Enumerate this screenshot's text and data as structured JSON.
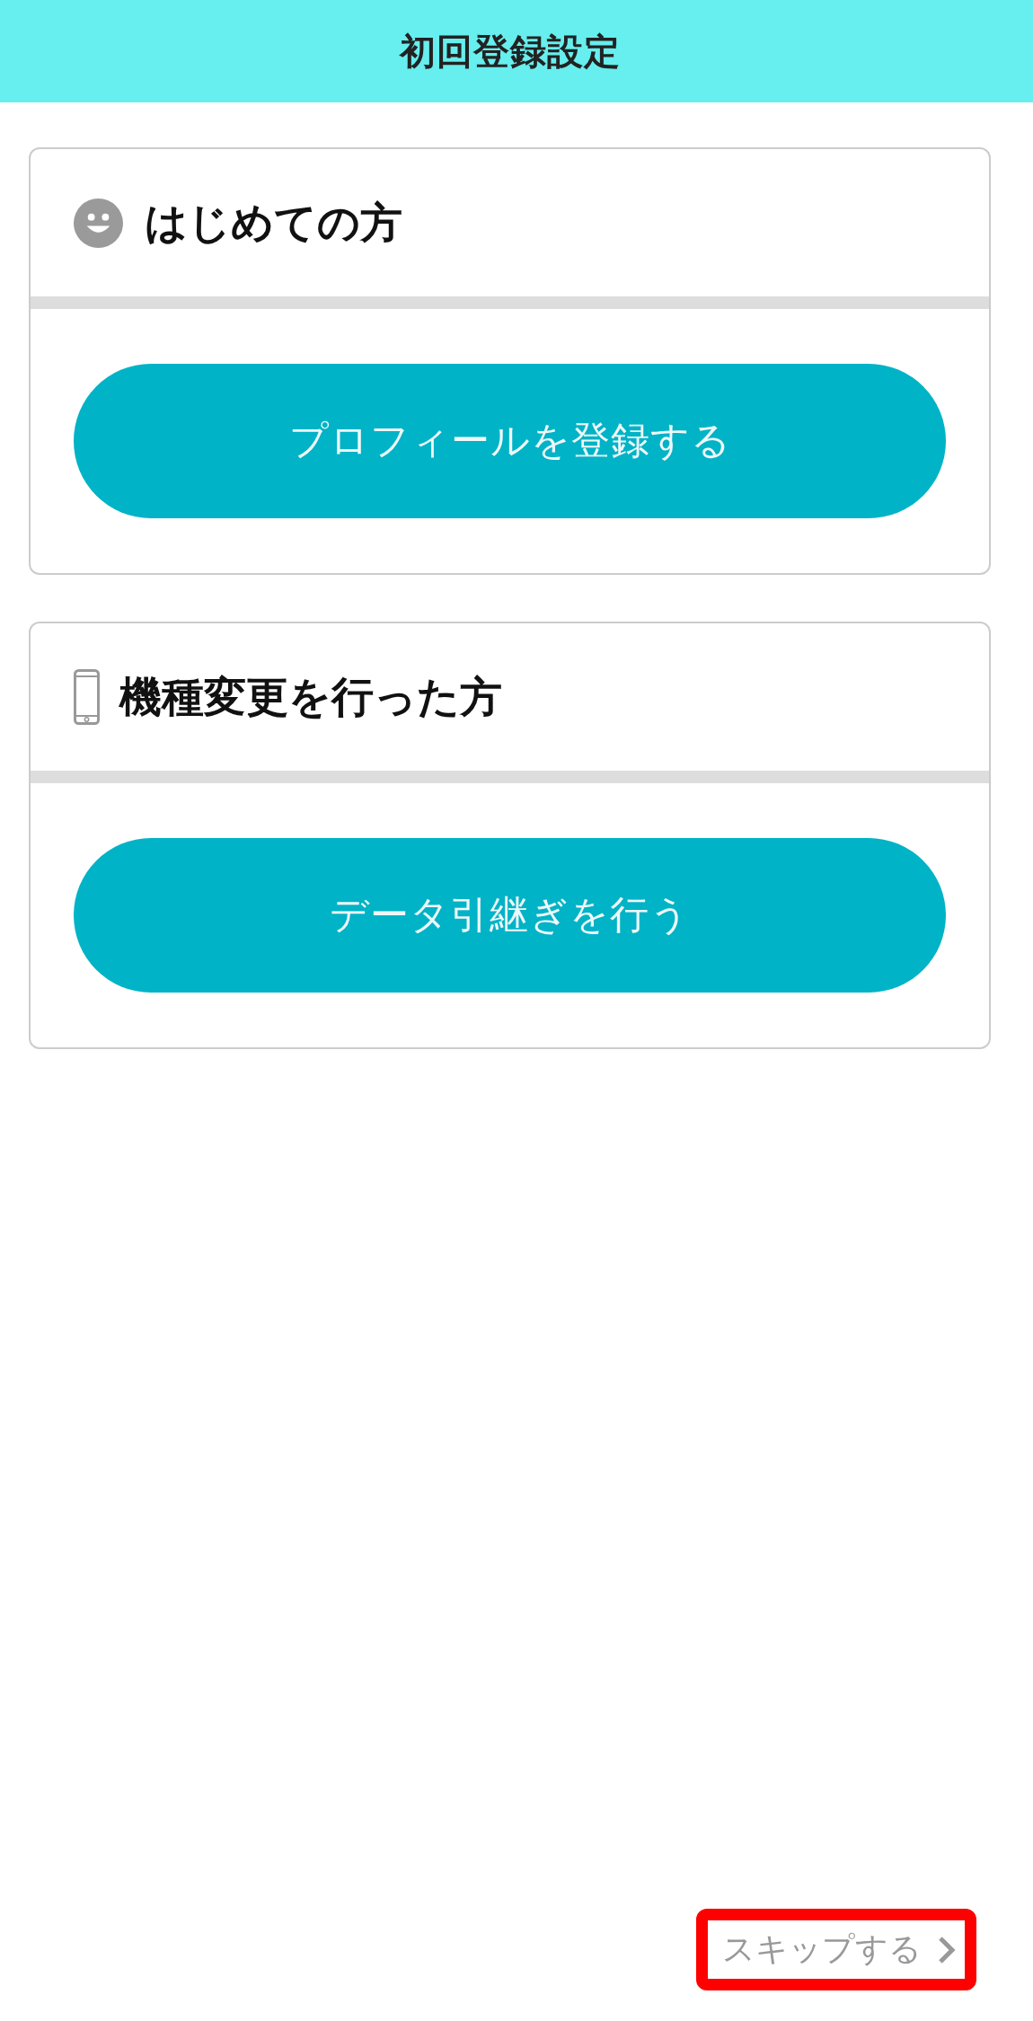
{
  "header": {
    "title": "初回登録設定"
  },
  "sections": [
    {
      "kind": "new_user",
      "title": "はじめての方",
      "button": "プロフィールを登録する"
    },
    {
      "kind": "device_change",
      "title": "機種変更を行った方",
      "button": "データ引継ぎを行う"
    }
  ],
  "skip_link": {
    "label": "スキップする",
    "highlighted": true
  }
}
